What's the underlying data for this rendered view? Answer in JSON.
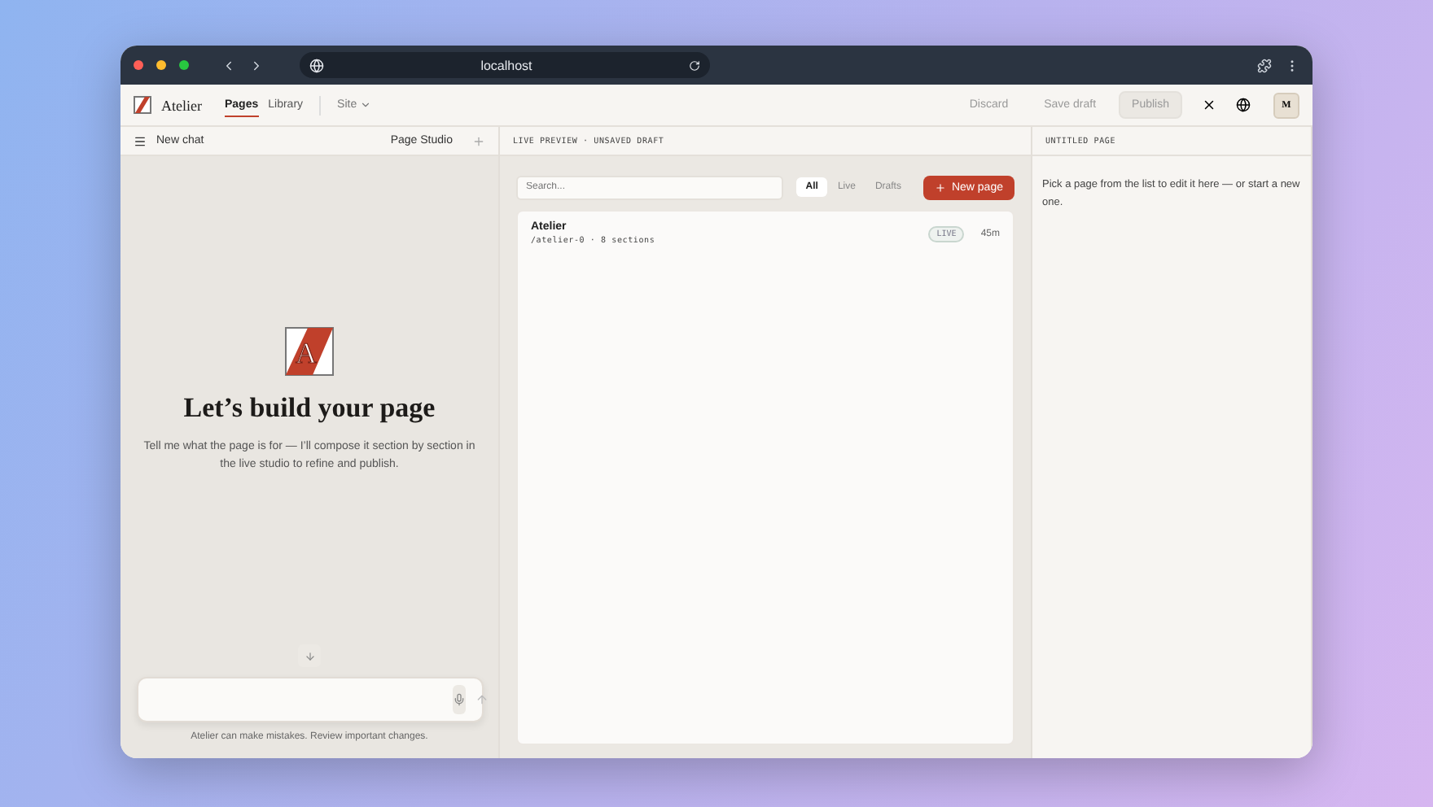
{
  "browser": {
    "url": "localhost"
  },
  "header": {
    "brand": "Atelier",
    "nav": [
      {
        "label": "Pages",
        "selected": true
      },
      {
        "label": "Library",
        "selected": false
      }
    ],
    "site_menu": "Site",
    "actions": [
      {
        "label": "Discard",
        "kind": "plain"
      },
      {
        "label": "Save draft",
        "kind": "plain"
      },
      {
        "label": "Publish",
        "kind": "filled"
      }
    ],
    "avatar": "M"
  },
  "chat": {
    "new_chat": "New chat",
    "title": "Page Studio",
    "logo_letter": "A",
    "heading": "Let’s build your page",
    "intro": "Tell me what the page is for — I’ll compose it section by section in the live studio to refine and publish.",
    "disclaimer": "Atelier can make mistakes. Review important changes."
  },
  "preview": {
    "title": "LIVE PREVIEW · UNSAVED DRAFT",
    "search": {
      "placeholder": "Search..."
    },
    "filters": [
      {
        "label": "All",
        "selected": true
      },
      {
        "label": "Live",
        "selected": false
      },
      {
        "label": "Drafts",
        "selected": false
      }
    ],
    "new_page": "New page",
    "pages": [
      {
        "name": "Atelier",
        "path": "/atelier-0 · 8 sections",
        "status": "LIVE",
        "age": "45m"
      }
    ]
  },
  "editor": {
    "title": "UNTITLED PAGE",
    "hint": "Pick a page from the list to edit it here — or start a new one."
  }
}
